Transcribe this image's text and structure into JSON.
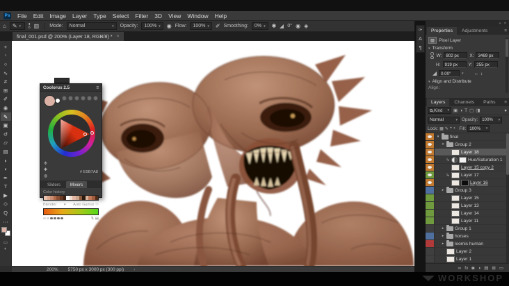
{
  "menu": {
    "logo": "Ps",
    "items": [
      "File",
      "Edit",
      "Image",
      "Layer",
      "Type",
      "Select",
      "Filter",
      "3D",
      "View",
      "Window",
      "Help"
    ]
  },
  "options": {
    "home_icon": "⌂",
    "brush_icon": "✎",
    "brush_size": "6",
    "mode_label": "Mode:",
    "mode_value": "Normal",
    "opacity_label": "Opacity:",
    "opacity_value": "100%",
    "flow_label": "Flow:",
    "flow_value": "100%",
    "smoothing_label": "Smoothing:",
    "smoothing_value": "0%",
    "angle_value": "0°"
  },
  "doc_tab": {
    "title": "final_001.psd @ 200% (Layer 18, RGB/8) *",
    "close": "×"
  },
  "toolbar": {
    "foreground_color": "#dcb2a6",
    "tools": [
      {
        "name": "move-tool",
        "glyph": "+"
      },
      {
        "name": "marquee-tool",
        "glyph": "▫"
      },
      {
        "name": "lasso-tool",
        "glyph": "○"
      },
      {
        "name": "quick-selection-tool",
        "glyph": "∿"
      },
      {
        "name": "crop-tool",
        "glyph": "#"
      },
      {
        "name": "frame-tool",
        "glyph": "⊞"
      },
      {
        "name": "eyedropper-tool",
        "glyph": "✐"
      },
      {
        "name": "healing-brush-tool",
        "glyph": "◉"
      },
      {
        "name": "brush-tool",
        "glyph": "✎",
        "selected": true
      },
      {
        "name": "clone-stamp-tool",
        "glyph": "▣"
      },
      {
        "name": "history-brush-tool",
        "glyph": "↺"
      },
      {
        "name": "eraser-tool",
        "glyph": "▱"
      },
      {
        "name": "gradient-tool",
        "glyph": "▤"
      },
      {
        "name": "blur-tool",
        "glyph": "◗"
      },
      {
        "name": "dodge-tool",
        "glyph": "◖"
      },
      {
        "name": "pen-tool",
        "glyph": "✒"
      },
      {
        "name": "type-tool",
        "glyph": "T"
      },
      {
        "name": "path-selection-tool",
        "glyph": "▶"
      },
      {
        "name": "shape-tool",
        "glyph": "◇"
      },
      {
        "name": "zoom-tool",
        "glyph": "Q"
      },
      {
        "name": "more-tools",
        "glyph": "⋯"
      }
    ]
  },
  "coolorus": {
    "title": "Coolorus 2.5",
    "hex": "# E9B7A8",
    "current_color": "#dcb2a6",
    "tabs": [
      "Sliders",
      "Mixers"
    ],
    "active_tab": "Mixers",
    "color_history_label": "Color history",
    "blender_label": "Blender",
    "auto_gamut_label": "Auto Gamut",
    "history_colors": [
      "#e7c0b0",
      "#d9a88f",
      "#c98e74",
      "#b06a4a",
      "#8a4f35",
      "#6b3a24",
      "#3c2114",
      "#ffffff",
      "#f0ddcf",
      "#e3b6a4",
      "#caa58e",
      "#8d5a3c",
      "#2b1a10",
      "#d9b49c",
      "#c1795a",
      "#a05c3e",
      "#4f2c1a"
    ],
    "blender_gradient": [
      "#e85c10",
      "#e8a818",
      "#a8c818",
      "#55d81a"
    ]
  },
  "minidock": [
    {
      "name": "brush-settings-icon",
      "glyph": "✑"
    },
    {
      "name": "character-panel-icon",
      "glyph": "A"
    },
    {
      "name": "paragraph-panel-icon",
      "glyph": "¶"
    }
  ],
  "properties": {
    "tabs": [
      "Properties",
      "Adjustments"
    ],
    "active_tab": "Properties",
    "layer_type": "Pixel Layer",
    "transform_label": "Transform",
    "w_label": "W:",
    "w_value": "802 px",
    "x_label": "X:",
    "x_value": "3469 px",
    "h_label": "H:",
    "h_value": "919 px",
    "y_label": "Y:",
    "y_value": "255 px",
    "angle_value": "0.00°",
    "align_section_label": "Align and Distribute",
    "align_label": "Align:"
  },
  "layers_panel": {
    "tabs": [
      "Layers",
      "Channels",
      "Paths"
    ],
    "active_tab": "Layers",
    "filter_label": "Kind",
    "blend_mode": "Normal",
    "opacity_label": "Opacity:",
    "opacity_value": "100%",
    "lock_label": "Lock:",
    "fill_label": "Fill:",
    "fill_value": "100%",
    "layers": [
      {
        "name": "final",
        "type": "group-open",
        "ind": "ind0",
        "label_color": "#c1792f",
        "visible": true
      },
      {
        "name": "Group 2",
        "type": "group-open",
        "ind": "ind1",
        "label_color": "#c1792f",
        "visible": true
      },
      {
        "name": "Layer 18",
        "type": "layer",
        "ind": "ind2",
        "label_color": "#c1792f",
        "visible": true,
        "selected": true
      },
      {
        "name": "Hue/Saturation 1",
        "type": "adjustment",
        "ind": "ind2",
        "label_color": "#c1792f",
        "visible": true,
        "clipped": true
      },
      {
        "name": "Layer 15 copy 2",
        "type": "layer",
        "ind": "ind2",
        "label_color": "#c1792f",
        "visible": true,
        "underline": true
      },
      {
        "name": "Layer 17",
        "type": "layer",
        "ind": "ind2",
        "label_color": "#6f9a3d",
        "visible": true,
        "clipped": true
      },
      {
        "name": "Layer 16",
        "type": "layer-mask",
        "ind": "ind2",
        "label_color": "#c1792f",
        "visible": true,
        "underline": true
      },
      {
        "name": "Group 3",
        "type": "group-closed",
        "ind": "ind1",
        "label_color": "#4f6f9f",
        "visible": false
      },
      {
        "name": "Layer 15",
        "type": "layer",
        "ind": "ind2",
        "label_color": "#6f9a3d",
        "visible": false
      },
      {
        "name": "Layer 13",
        "type": "layer",
        "ind": "ind2",
        "label_color": "#6f9a3d",
        "visible": false
      },
      {
        "name": "Layer 14",
        "type": "layer",
        "ind": "ind2",
        "label_color": "#6f9a3d",
        "visible": false
      },
      {
        "name": "Layer 11",
        "type": "layer",
        "ind": "ind2",
        "label_color": "#6f9a3d",
        "visible": false
      },
      {
        "name": "Group 1",
        "type": "group-closed",
        "ind": "ind1",
        "label_color": "",
        "visible": false
      },
      {
        "name": "horses",
        "type": "group-closed",
        "ind": "ind1",
        "label_color": "#4f6f9f",
        "visible": false
      },
      {
        "name": "loomis human",
        "type": "group-closed",
        "ind": "ind1",
        "label_color": "#b03a3a",
        "visible": false
      },
      {
        "name": "Layer 2",
        "type": "layer",
        "ind": "ind1",
        "label_color": "",
        "visible": false
      },
      {
        "name": "Layer 1",
        "type": "layer",
        "ind": "ind1",
        "label_color": "",
        "visible": false
      }
    ],
    "bottom_icons": [
      {
        "name": "link-layers-icon",
        "glyph": "∞"
      },
      {
        "name": "layer-effects-icon",
        "glyph": "fx"
      },
      {
        "name": "layer-mask-icon",
        "glyph": "◙"
      },
      {
        "name": "adjustment-layer-icon",
        "glyph": "◑"
      },
      {
        "name": "new-group-icon",
        "glyph": "▤"
      },
      {
        "name": "new-layer-icon",
        "glyph": "⊞"
      },
      {
        "name": "delete-layer-icon",
        "glyph": "▭"
      }
    ]
  },
  "statusbar": {
    "zoom": "200%",
    "doc_info": "5750 px x 3000 px (300 ppi)"
  },
  "watermark": "WORKSHOP"
}
